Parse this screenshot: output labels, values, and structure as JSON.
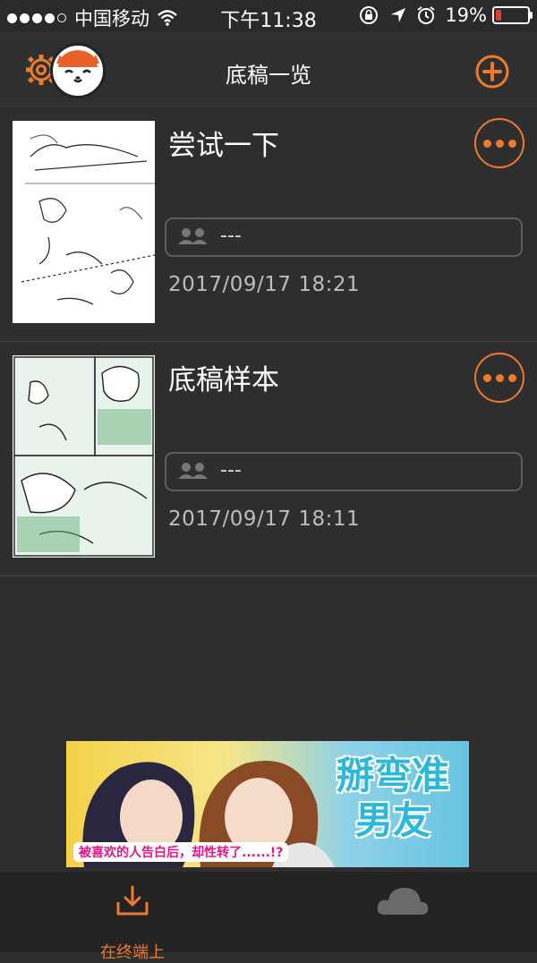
{
  "status_bar": {
    "carrier": "中国移动",
    "time": "下午11:38",
    "battery": "19%"
  },
  "nav": {
    "title": "底稿一览"
  },
  "drafts": [
    {
      "title": "尝试一下",
      "share": "---",
      "date": "2017/09/17 18:21"
    },
    {
      "title": "底稿样本",
      "share": "---",
      "date": "2017/09/17 18:11"
    }
  ],
  "ad": {
    "headline": "掰弯准男友",
    "caption": "被喜欢的人告白后，却性转了......!?"
  },
  "tabs": {
    "local_label": "在终端上"
  },
  "colors": {
    "accent": "#ee7a2c",
    "background": "#2e2e2e"
  }
}
